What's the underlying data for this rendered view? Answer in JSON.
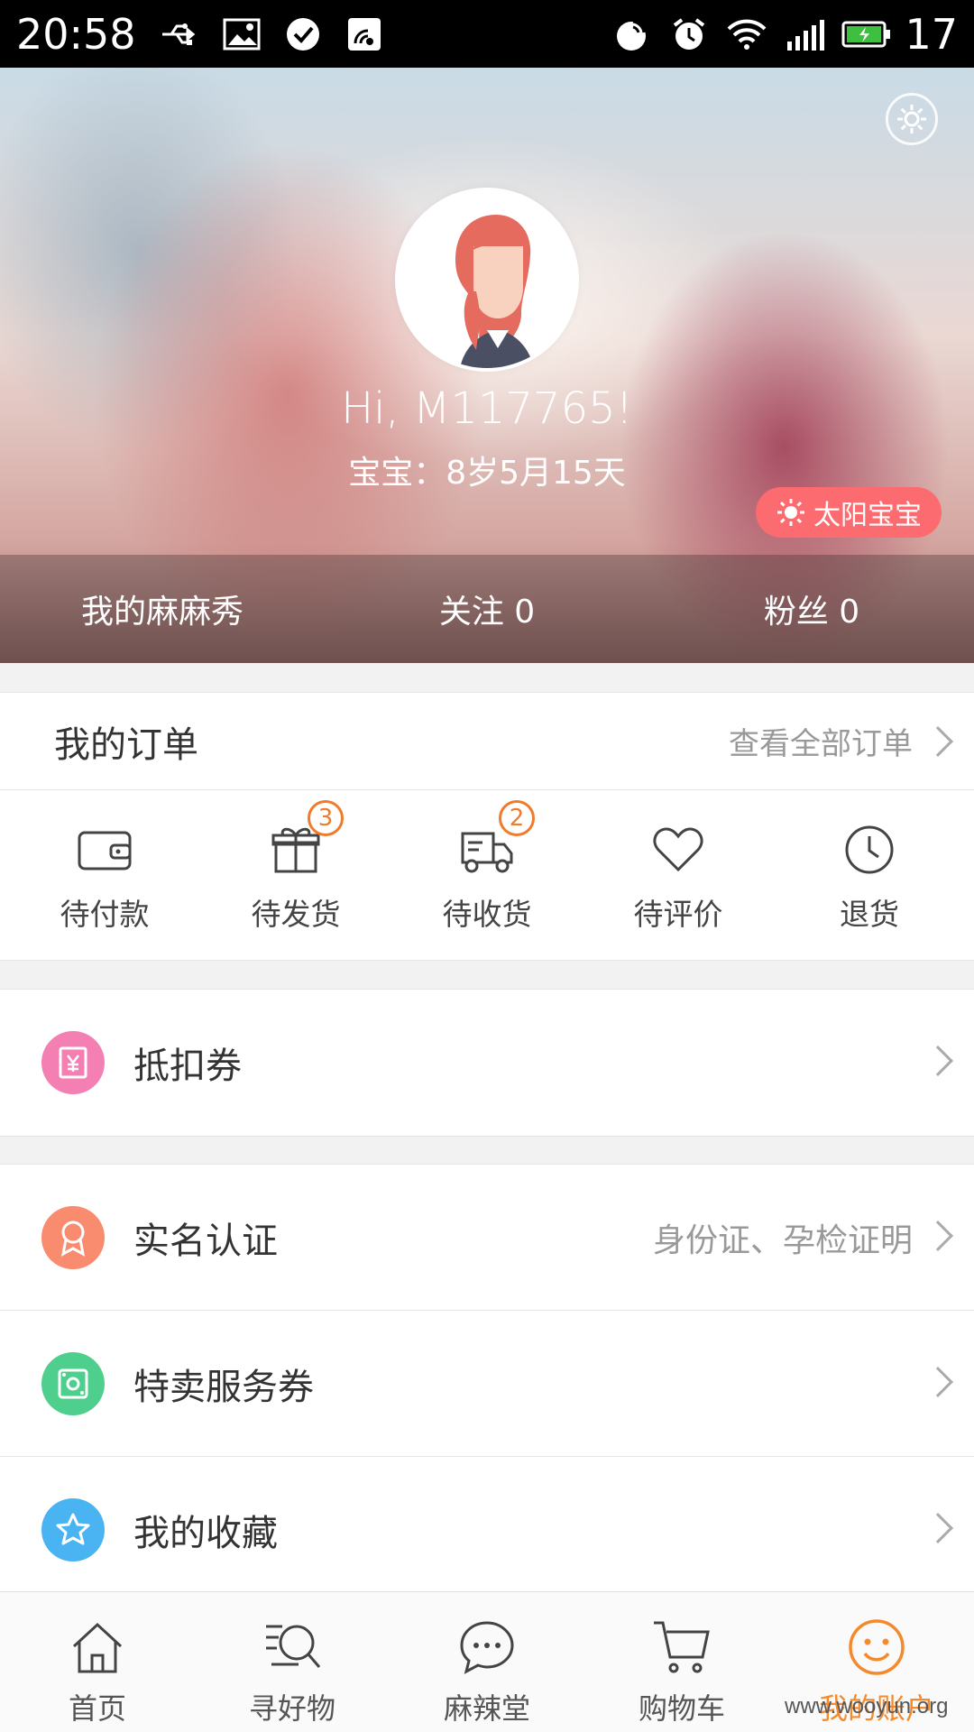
{
  "status_bar": {
    "time": "20:58",
    "battery_level": "17"
  },
  "profile": {
    "greeting": "Hi, M117765!",
    "baby_age": "宝宝：8岁5月15天",
    "badge": "太阳宝宝",
    "stats": [
      {
        "label": "我的麻麻秀"
      },
      {
        "label": "关注 0"
      },
      {
        "label": "粉丝 0"
      }
    ]
  },
  "orders": {
    "title": "我的订单",
    "view_all": "查看全部订单",
    "items": [
      {
        "label": "待付款",
        "icon": "wallet-icon",
        "badge": ""
      },
      {
        "label": "待发货",
        "icon": "gift-icon",
        "badge": "3"
      },
      {
        "label": "待收货",
        "icon": "truck-icon",
        "badge": "2"
      },
      {
        "label": "待评价",
        "icon": "heart-icon",
        "badge": ""
      },
      {
        "label": "退货",
        "icon": "clock-icon",
        "badge": ""
      }
    ]
  },
  "menu": {
    "coupon": {
      "label": "抵扣券",
      "icon": "coupon-icon",
      "color": "#f47fb3"
    },
    "realname": {
      "label": "实名认证",
      "note": "身份证、孕检证明",
      "icon": "ribbon-icon",
      "color": "#f98b6e"
    },
    "service": {
      "label": "特卖服务券",
      "icon": "ticket-icon",
      "color": "#4fcf8e"
    },
    "favorites": {
      "label": "我的收藏",
      "icon": "star-icon",
      "color": "#4ab3f2"
    }
  },
  "tabbar": {
    "items": [
      {
        "label": "首页",
        "icon": "home-icon"
      },
      {
        "label": "寻好物",
        "icon": "search-goods-icon"
      },
      {
        "label": "麻辣堂",
        "icon": "chat-icon"
      },
      {
        "label": "购物车",
        "icon": "cart-icon"
      },
      {
        "label": "我的账户",
        "icon": "smile-icon"
      }
    ],
    "active_color": "#f58a2c"
  },
  "watermark": "www.wooyun.org"
}
